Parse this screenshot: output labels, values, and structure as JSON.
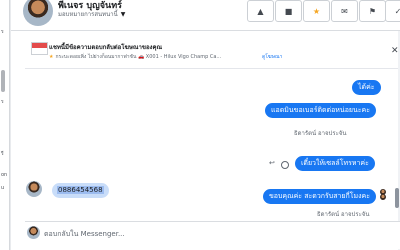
{
  "colors": {
    "accent": "#1877f2",
    "bubble_in": "#e4e6eb",
    "page_bg": "#e9ebee"
  },
  "header": {
    "contact_name": "พีเนจร บุญจันทร์",
    "contact_sub": "มอบหมายการสนทนานี้",
    "buttons": {
      "warning_icon": "warning-icon",
      "delete_icon": "trash-icon",
      "star_icon": "star-icon",
      "mail_icon": "mail-icon",
      "bot_icon": "bot-icon",
      "check_icon": "check-icon"
    }
  },
  "left_rail": {
    "labels": [
      "ร",
      "ร",
      "รี",
      "on",
      "u"
    ]
  },
  "ad_card": {
    "title": "แชทนี้มีข้อความตอบกลับต่อโฆษณาของคุณ",
    "description": "กระบะดอยเพิ่ง ไปย่างก็อนมากาฟาชัน 🚗 X001 - Hilux Vigo Champ Ca...",
    "link": "ดูโฆษณา"
  },
  "messages": [
    {
      "direction": "out",
      "text": "ได้ค่ะ"
    },
    {
      "direction": "out",
      "text": "แอดมินขอเบอร์ติดต่อหน่อยนะคะ"
    },
    {
      "direction": "out",
      "sender": "ธิดารัตน์ อาจประจัน",
      "text": "เดี๋ยวให้เซลล์โทรหาค่ะ"
    },
    {
      "direction": "in",
      "text": "0886454568"
    },
    {
      "direction": "out",
      "sender": "ธิดารัตน์ อาจประจัน",
      "text": "ขอบคุณค่ะ สะดวกรับสายกี่โมงคะ"
    }
  ],
  "composer": {
    "placeholder": "ตอบกลับใน Messenger..."
  }
}
